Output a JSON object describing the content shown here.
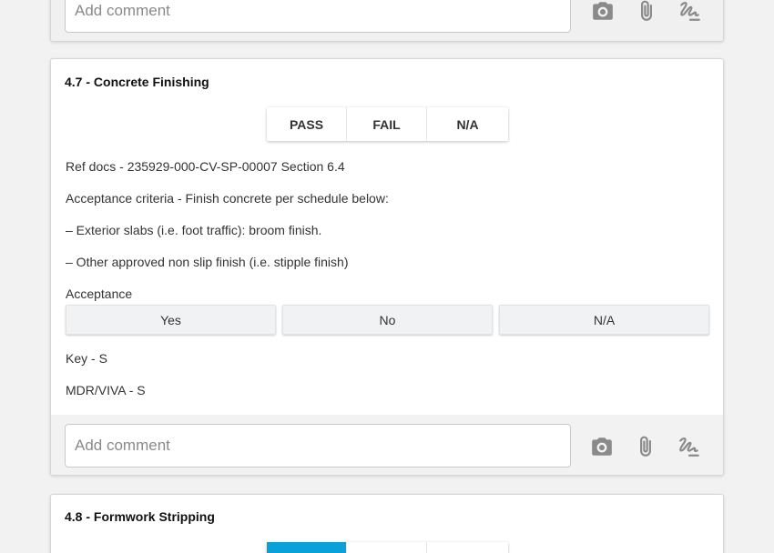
{
  "comment": {
    "placeholder": "Add comment"
  },
  "icons": {
    "camera": "camera-icon",
    "attach": "paperclip-icon",
    "signature": "signature-icon"
  },
  "colors": {
    "active_segment": "#0aa0d8",
    "icon": "#8a8a8a"
  },
  "sections": [
    {
      "title": "4.7 - Concrete Finishing",
      "result_options": [
        "PASS",
        "FAIL",
        "N/A"
      ],
      "lines": [
        "Ref docs - 235929-000-CV-SP-00007 Section 6.4",
        "Acceptance criteria - Finish concrete per schedule below:",
        "– Exterior slabs (i.e. foot traffic): broom finish.",
        "– Other approved non slip finish (i.e. stipple finish)",
        "Acceptance"
      ],
      "acceptance_options": [
        "Yes",
        "No",
        "N/A"
      ],
      "after_lines": [
        "Key - S",
        "MDR/VIVA - S"
      ]
    },
    {
      "title": "4.8 - Formwork Stripping",
      "selected_result": "PASS"
    }
  ]
}
